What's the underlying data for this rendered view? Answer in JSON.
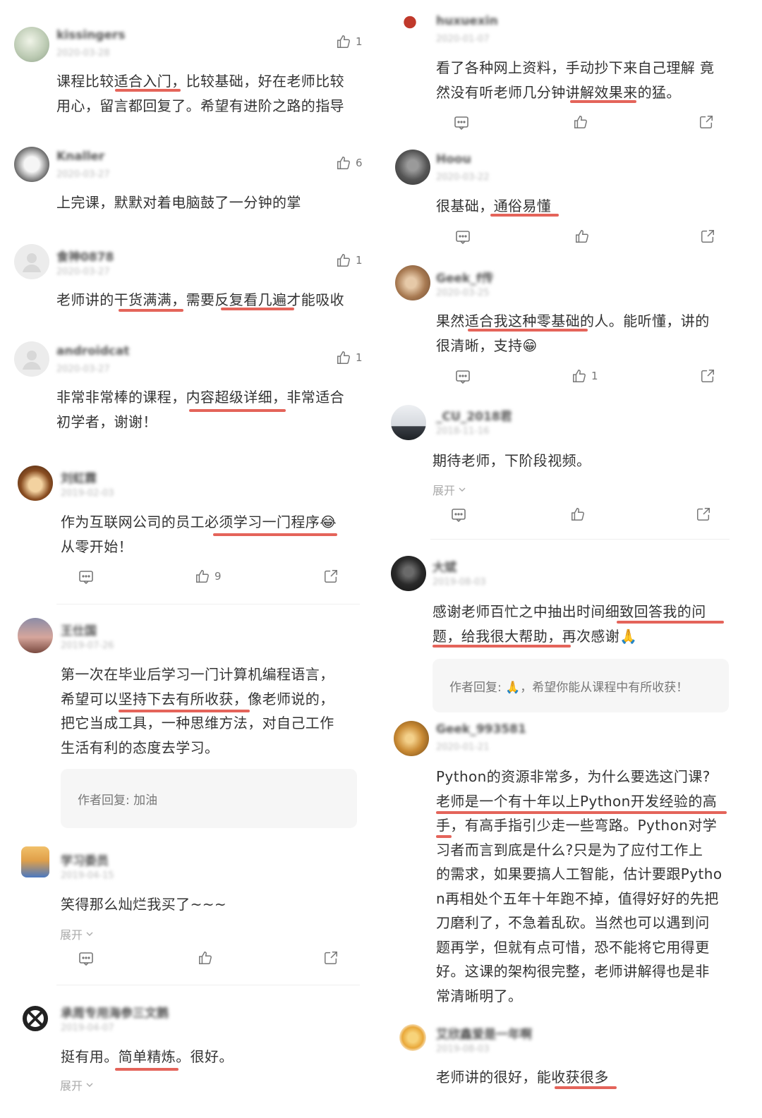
{
  "left": [
    {
      "username": "kissingers",
      "date": "2020-03-28",
      "likes": "1",
      "text": [
        "课程比较适合入门，比较基础，好在老师比较",
        "用心，留言都回复了。希望有进阶之路的指导"
      ]
    },
    {
      "username": "Knaller",
      "date": "2020-03-27",
      "likes": "6",
      "text": [
        "上完课，默默对着电脑鼓了一分钟的掌"
      ]
    },
    {
      "username": "食神0878",
      "date": "2020-03-27",
      "likes": "1",
      "text": [
        "老师讲的干货满满，需要反复看几遍才能吸收"
      ]
    },
    {
      "username": "androidcat",
      "date": "2020-03-27",
      "likes": "1",
      "text": [
        "非常非常棒的课程，内容超级详细，非常适合",
        "初学者，谢谢！"
      ]
    },
    {
      "username": "刘虹霖",
      "date": "2019-02-03",
      "likes": "9",
      "text": [
        "作为互联网公司的员工必须学习一门程序😂",
        "从零开始！"
      ]
    },
    {
      "username": "王仕国",
      "date": "2019-07-26",
      "text": [
        "第一次在毕业后学习一门计算机编程语言，",
        "希望可以坚持下去有所收获，像老师说的，",
        "把它当成工具，一种思维方法，对自己工作",
        "生活有利的态度去学习。"
      ],
      "reply": "作者回复: 加油"
    },
    {
      "username": "学习委员",
      "date": "2019-04-15",
      "text": [
        "笑得那么灿烂我买了~~~"
      ],
      "expand": "展开"
    },
    {
      "username": "承周专用海参三文鹅",
      "date": "2019-04-07",
      "text": [
        "挺有用。简单精炼。很好。"
      ],
      "expand": "展开"
    }
  ],
  "right": [
    {
      "username": "huxuexin",
      "date": "2020-01-07",
      "text": [
        "看了各种网上资料，手动抄下来自己理解 竟",
        "然没有听老师几分钟讲解效果来的猛。"
      ]
    },
    {
      "username": "Hoou",
      "date": "2020-03-22",
      "text": [
        "很基础，通俗易懂"
      ]
    },
    {
      "username": "Geek_f传",
      "date": "2020-03-25",
      "likes": "1",
      "text": [
        "果然适合我这种零基础的人。能听懂，讲的",
        "很清晰，支持😁"
      ]
    },
    {
      "username": "_CU_2018君",
      "date": "2018-11-16",
      "text": [
        "期待老师，下阶段视频。"
      ],
      "expand": "展开"
    },
    {
      "username": "大斌",
      "date": "2019-08-03",
      "text": [
        "感谢老师百忙之中抽出时间细致回答我的问",
        "题，给我很大帮助，再次感谢🙏"
      ],
      "reply": "作者回复: 🙏，希望你能从课程中有所收获！"
    },
    {
      "username": "Geek_993581",
      "date": "2020-01-21",
      "text": [
        "Python的资源非常多，为什么要选这门课?",
        "老师是一个有十年以上Python开发经验的高",
        "手，有高手指引少走一些弯路。Python对学",
        "习者而言到底是什么?只是为了应付工作上",
        "的需求，如果要搞人工智能，估计要跟Pytho",
        "n再相处个五年十年跑不掉，值得好好的先把",
        "刀磨利了，不急着乱砍。当然也可以遇到问",
        "题再学，但就有点可惜，恐不能将它用得更",
        "好。这课的架构很完整，老师讲解得也是非",
        "常清晰明了。"
      ]
    },
    {
      "username": "艾欣鑫爱是一年啊",
      "date": "2019-08-03",
      "text": [
        "老师讲的很好，能收获很多"
      ]
    }
  ],
  "icons": {
    "like": "thumbs-up-icon",
    "comment": "comment-icon",
    "share": "share-icon",
    "expand": "chevron-down-icon"
  },
  "colors": {
    "underline": "#e4645a",
    "text": "#333333",
    "muted": "#aaaaaa",
    "reply_bg": "#f6f6f6"
  }
}
